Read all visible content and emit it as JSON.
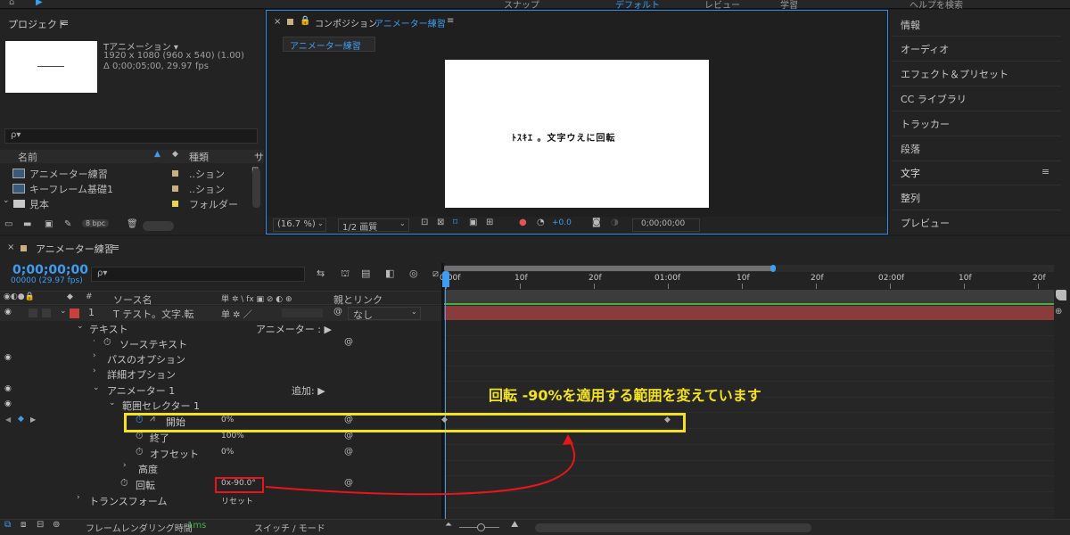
{
  "topbar": {
    "snap_label": "スナップ",
    "workspace": "デフォルト",
    "review": "レビュー",
    "learn": "学習",
    "help_placeholder": "ヘルプを検索"
  },
  "project_panel": {
    "title": "プロジェクト",
    "menu": "≡",
    "comp_name": "Tアニメーション ▾",
    "comp_info_1": "1920 x 1080  (960 x 540) (1.00)",
    "comp_info_2": "Δ 0;00;05;00, 29.97 fps",
    "search_placeholder": "ρ▾",
    "col_name": "名前",
    "col_type": "種類",
    "col_size": "サ",
    "items": [
      {
        "name": "アニメーター練習",
        "type": "..ション",
        "color": "#c7b184"
      },
      {
        "name": "キーフレーム基礎1",
        "type": "..ション",
        "color": "#c7b184"
      },
      {
        "name": "見本",
        "type": "フォルダー",
        "color": "#e8d44a"
      }
    ],
    "bpc": "8 bpc"
  },
  "comp_panel": {
    "title_prefix": "コンポジション",
    "title_name": "アニメーター練習",
    "tab_label": "アニメーター練習",
    "canvas_text": "ﾄｽｷｴ 。文字ウえに回転",
    "zoom": "(16.7 %)",
    "quality": "1/2 画質",
    "exposure": "+0.0",
    "timecode": "0;00;00;00"
  },
  "right_panel": {
    "items": [
      "情報",
      "オーディオ",
      "エフェクト＆プリセット",
      "CC ライブラリ",
      "トラッカー",
      "段落",
      "文字",
      "整列",
      "プレビュー"
    ]
  },
  "timeline": {
    "tab_title": "アニメーター練習",
    "timecode": "0;00;00;00",
    "fps_info": "00000 (29.97 fps)",
    "search_placeholder": "ρ▾",
    "col_source": "ソース名",
    "col_switches": "単 ✲ \\ fx ▣ ⊘ ◐ ⊕",
    "col_parent": "親とリンク",
    "layer_number": "1",
    "layer_name": "T  テスト。文字.転",
    "layer_switch": "单 ✲ ／",
    "parent_value": "なし",
    "rows": {
      "text_group": "テキスト",
      "animator_label": "アニメーター : ▶",
      "source_text": "ソーステキスト",
      "path_options": "パスのオプション",
      "detail_options": "詳細オプション",
      "animator1": "アニメーター 1",
      "add_label": "追加: ▶",
      "range_selector": "範囲セレクター 1",
      "start": "開始",
      "start_value": "0%",
      "end": "終了",
      "end_value": "100%",
      "offset": "オフセット",
      "offset_value": "0%",
      "advanced": "高度",
      "rotation": "回転",
      "rotation_value": "0x-90.0°",
      "transform": "トランスフォーム",
      "reset": "リセット"
    },
    "ruler": [
      "0:00f",
      "10f",
      "20f",
      "01:00f",
      "10f",
      "20f",
      "02:00f",
      "10f",
      "20f"
    ],
    "bottom_render": "フレームレンダリング時間",
    "bottom_render_value": "1ms",
    "bottom_switch": "スイッチ / モード"
  },
  "annotation": {
    "text": "回転 -90%を適用する範囲を変えています",
    "color": "#f2e21f"
  }
}
